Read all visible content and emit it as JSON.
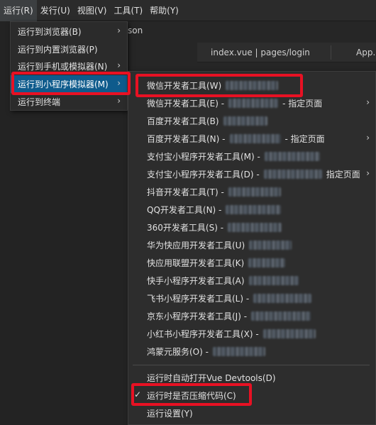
{
  "menubar": {
    "items": [
      "运行(R)",
      "发行(U)",
      "视图(V)",
      "工具(T)",
      "帮助(Y)"
    ]
  },
  "background": {
    "son_text": "son",
    "tab1": "index.vue | pages/login",
    "tab2": "App."
  },
  "run_menu": {
    "items": [
      {
        "label": "运行到浏览器(B)",
        "has_submenu": true
      },
      {
        "label": "运行到内置浏览器(P)",
        "has_submenu": false
      },
      {
        "label": "运行到手机或模拟器(N)",
        "has_submenu": true
      },
      {
        "label": "运行到小程序模拟器(M)",
        "has_submenu": true
      },
      {
        "label": "运行到终端",
        "has_submenu": true
      }
    ]
  },
  "miniprogram_menu": {
    "items": [
      {
        "label": "微信开发者工具(W)",
        "suffix": "",
        "has_submenu": false
      },
      {
        "label": "微信开发者工具(E) -",
        "suffix": "- 指定页面",
        "has_submenu": true
      },
      {
        "label": "百度开发者工具(B)",
        "suffix": "",
        "has_submenu": false
      },
      {
        "label": "百度开发者工具(N) -",
        "suffix": "- 指定页面",
        "has_submenu": true
      },
      {
        "label": "支付宝小程序开发者工具(M) -",
        "suffix": "",
        "has_submenu": false
      },
      {
        "label": "支付宝小程序开发者工具(D) -",
        "suffix": "指定页面",
        "has_submenu": true
      },
      {
        "label": "抖音开发者工具(T) -",
        "suffix": "",
        "has_submenu": false
      },
      {
        "label": "QQ开发者工具(N) -",
        "suffix": "",
        "has_submenu": false
      },
      {
        "label": "360开发者工具(S) -",
        "suffix": "",
        "has_submenu": false
      },
      {
        "label": "华为快应用开发者工具(U)",
        "suffix": "",
        "has_submenu": false
      },
      {
        "label": "快应用联盟开发者工具(K)",
        "suffix": "",
        "has_submenu": false
      },
      {
        "label": "快手小程序开发者工具(A)",
        "suffix": "",
        "has_submenu": false
      },
      {
        "label": "飞书小程序开发者工具(L) -",
        "suffix": "",
        "has_submenu": false
      },
      {
        "label": "京东小程序开发者工具(J) -",
        "suffix": "",
        "has_submenu": false
      },
      {
        "label": "小红书小程序开发者工具(X) -",
        "suffix": "",
        "has_submenu": false
      },
      {
        "label": "鸿蒙元服务(O) -",
        "suffix": "",
        "has_submenu": false
      }
    ],
    "bottom_items": [
      {
        "label": "运行时自动打开Vue Devtools(D)",
        "checked": false
      },
      {
        "label": "运行时是否压缩代码(C)",
        "checked": true
      },
      {
        "label": "运行设置(Y)",
        "checked": false
      }
    ]
  },
  "icons": {
    "submenu": "chevron-right-icon",
    "check": "check-icon"
  },
  "colors": {
    "highlight": "#0e5b8c",
    "annotation": "#e81123",
    "menu_bg": "#2d2d2d"
  }
}
